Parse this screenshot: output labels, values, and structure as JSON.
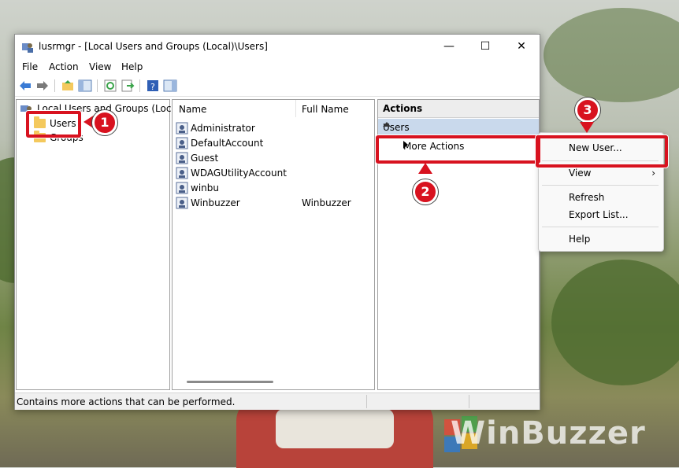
{
  "window": {
    "title": "lusrmgr - [Local Users and Groups (Local)\\Users]",
    "minimize_glyph": "—",
    "maximize_glyph": "☐",
    "close_glyph": "✕"
  },
  "menubar": {
    "items": [
      {
        "label": "File"
      },
      {
        "label": "Action"
      },
      {
        "label": "View"
      },
      {
        "label": "Help"
      }
    ]
  },
  "toolbar": {
    "icons": [
      "back-icon",
      "forward-icon",
      "up-folder-icon",
      "show-hide-tree-icon",
      "refresh-icon",
      "export-list-icon",
      "help-icon",
      "show-hide-action-pane-icon"
    ]
  },
  "tree": {
    "root_label": "Local Users and Groups (Local)",
    "items": [
      {
        "label": "Users",
        "selected": true
      },
      {
        "label": "Groups",
        "selected": false
      }
    ]
  },
  "list": {
    "columns": [
      "Name",
      "Full Name"
    ],
    "rows": [
      {
        "name": "Administrator",
        "full_name": ""
      },
      {
        "name": "DefaultAccount",
        "full_name": ""
      },
      {
        "name": "Guest",
        "full_name": ""
      },
      {
        "name": "WDAGUtilityAccount",
        "full_name": ""
      },
      {
        "name": "winbu",
        "full_name": ""
      },
      {
        "name": "Winbuzzer",
        "full_name": "Winbuzzer"
      }
    ]
  },
  "actions": {
    "header": "Actions",
    "section": "Users",
    "more_actions": "More Actions"
  },
  "submenu": {
    "items": [
      "New User...",
      "View",
      "Refresh",
      "Export List...",
      "Help"
    ],
    "view_arrow": "›"
  },
  "status": {
    "text": "Contains more actions that can be performed."
  },
  "callouts": {
    "step1": "1",
    "step2": "2",
    "step3": "3"
  },
  "watermark": "WinBuzzer",
  "colors": {
    "highlight_red": "#d8121f",
    "section_blue": "#c9d9ec",
    "folder_yellow": "#f4c95d"
  }
}
